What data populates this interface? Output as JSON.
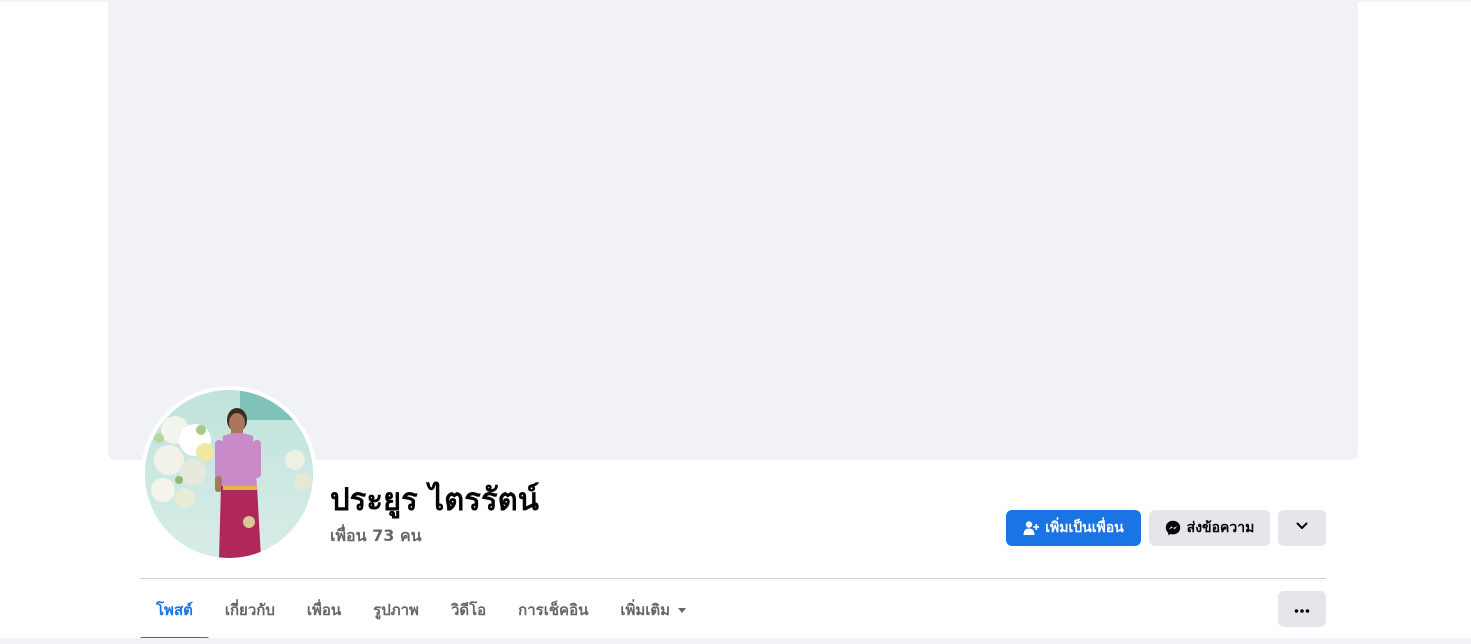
{
  "profile": {
    "name": "ประยูร ไตรรัตน์",
    "friends_text": "เพื่อน 73 คน"
  },
  "actions": {
    "add_friend_label": "เพิ่มเป็นเพื่อน",
    "message_label": "ส่งข้อความ",
    "add_friend_icon": "add-person-icon",
    "message_icon": "messenger-icon",
    "dropdown_icon": "chevron-down-icon",
    "more_icon": "more-dots-icon"
  },
  "tabs": [
    {
      "label": "โพสต์",
      "active": true
    },
    {
      "label": "เกี่ยวกับ",
      "active": false
    },
    {
      "label": "เพื่อน",
      "active": false
    },
    {
      "label": "รูปภาพ",
      "active": false
    },
    {
      "label": "วิดีโอ",
      "active": false
    },
    {
      "label": "การเช็คอิน",
      "active": false
    },
    {
      "label": "เพิ่มเติม",
      "active": false
    }
  ],
  "colors": {
    "accent": "#1b74e4",
    "cover_bg": "#f0f2f5",
    "secondary_btn": "#e4e6eb",
    "text_primary": "#050505",
    "text_secondary": "#65676b"
  }
}
